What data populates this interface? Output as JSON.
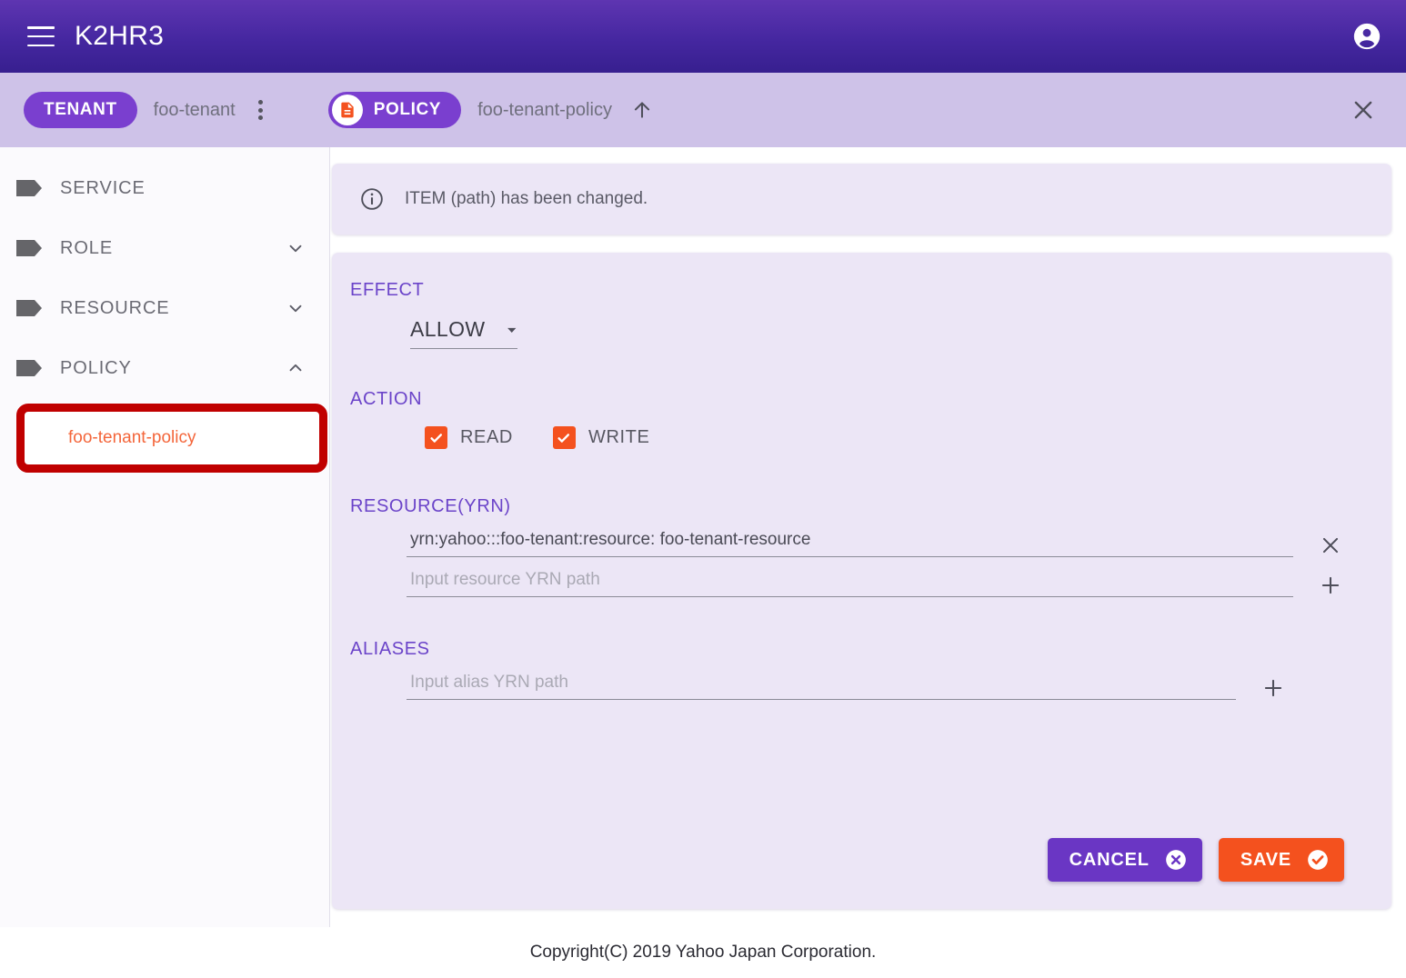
{
  "appbar": {
    "menu_icon": "hamburger-icon",
    "title": "K2HR3",
    "account_icon": "account-circle-icon"
  },
  "breadcrumb": {
    "tenant_chip": "TENANT",
    "tenant_name": "foo-tenant",
    "tenant_menu_icon": "more-vert-icon",
    "policy_chip": "POLICY",
    "policy_badge_icon": "policy-document-icon",
    "policy_name": "foo-tenant-policy",
    "up_icon": "arrow-up-icon",
    "close_icon": "close-icon"
  },
  "sidebar": {
    "items": [
      {
        "label": "SERVICE",
        "icon": "tag-icon",
        "expander": "none"
      },
      {
        "label": "ROLE",
        "icon": "tag-icon",
        "expander": "chevron-down-icon"
      },
      {
        "label": "RESOURCE",
        "icon": "tag-icon",
        "expander": "chevron-down-icon"
      },
      {
        "label": "POLICY",
        "icon": "tag-icon",
        "expander": "chevron-up-icon"
      }
    ],
    "selected_child": "foo-tenant-policy",
    "annotation_color": "#c00000",
    "selected_child_color": "#f4663b"
  },
  "notice": {
    "icon": "info-circle-icon",
    "text": "ITEM (path) has been changed."
  },
  "form": {
    "effect": {
      "label": "EFFECT",
      "value": "ALLOW",
      "caret_icon": "dropdown-caret-icon"
    },
    "action": {
      "label": "ACTION",
      "options": [
        {
          "label": "READ",
          "checked": true
        },
        {
          "label": "WRITE",
          "checked": true
        }
      ],
      "checkbox_color": "#f4511e"
    },
    "resource": {
      "label": "RESOURCE(YRN)",
      "value": "yrn:yahoo:::foo-tenant:resource: foo-tenant-resource",
      "remove_icon": "close-icon",
      "placeholder": "Input resource YRN path",
      "add_icon": "plus-icon"
    },
    "aliases": {
      "label": "ALIASES",
      "placeholder": "Input alias YRN path",
      "add_icon": "plus-icon"
    },
    "buttons": {
      "cancel": "CANCEL",
      "cancel_icon": "cancel-circle-icon",
      "cancel_color": "#6a36c4",
      "save": "SAVE",
      "save_icon": "check-circle-icon",
      "save_color": "#f4511e"
    }
  },
  "footer": {
    "text": "Copyright(C) 2019 Yahoo Japan Corporation."
  }
}
